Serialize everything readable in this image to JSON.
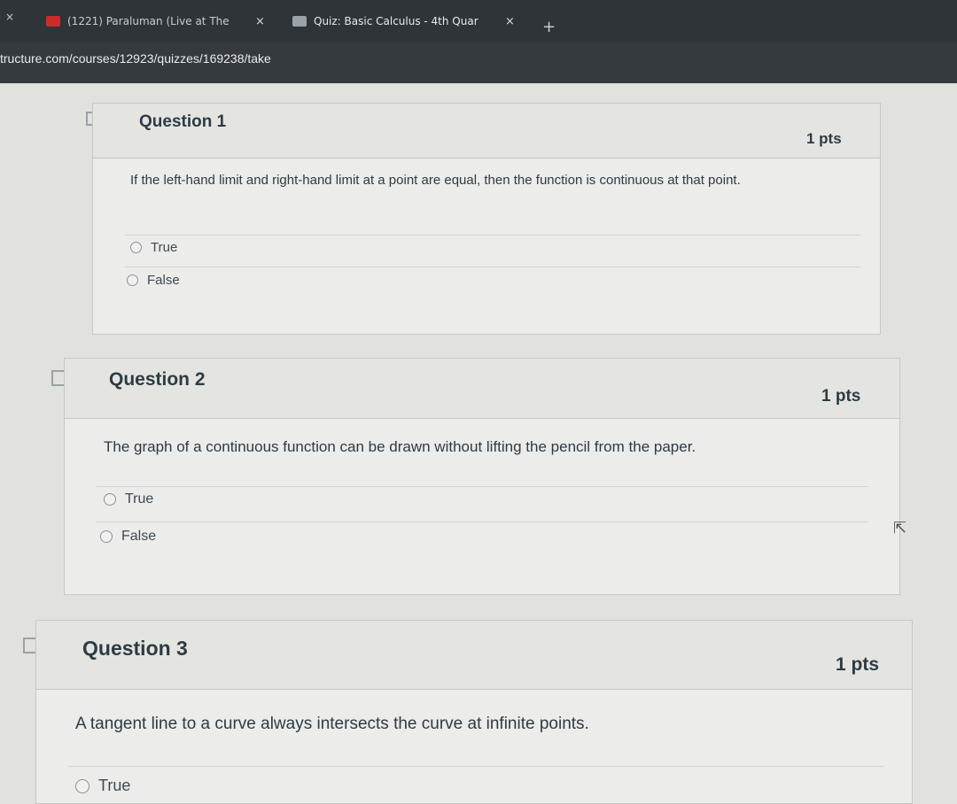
{
  "browser": {
    "tabs": [
      {
        "title": "(1221) Paraluman (Live at The",
        "close": "×"
      },
      {
        "title": "Quiz: Basic Calculus - 4th Quar",
        "close": "×"
      }
    ],
    "new_tab": "+",
    "url": "tructure.com/courses/12923/quizzes/169238/take"
  },
  "questions": [
    {
      "title": "Question 1",
      "points": "1 pts",
      "text": "If the left-hand limit and right-hand limit at a point are equal, then the function is continuous at that point.",
      "answers": [
        "True",
        "False"
      ]
    },
    {
      "title": "Question 2",
      "points": "1 pts",
      "text": "The graph of a continuous function can be drawn without lifting the pencil from the paper.",
      "answers": [
        "True",
        "False"
      ]
    },
    {
      "title": "Question 3",
      "points": "1 pts",
      "text": "A tangent line to a curve always intersects the curve at infinite points.",
      "answers": [
        "True"
      ]
    }
  ]
}
